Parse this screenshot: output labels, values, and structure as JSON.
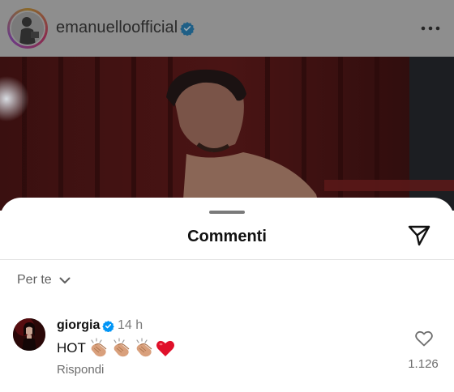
{
  "post": {
    "username": "emanuelloofficial",
    "verified": true
  },
  "sheet": {
    "title": "Commenti",
    "sort_label": "Per te"
  },
  "comment": {
    "username": "giorgia",
    "verified": true,
    "time": "14 h",
    "text": "HOT",
    "emojis": [
      "clapping-hands",
      "clapping-hands",
      "clapping-hands",
      "red-heart"
    ],
    "reply_label": "Rispondi",
    "likes": "1.126"
  },
  "colors": {
    "verified": "#0095f6",
    "heart": "#e0102a"
  }
}
